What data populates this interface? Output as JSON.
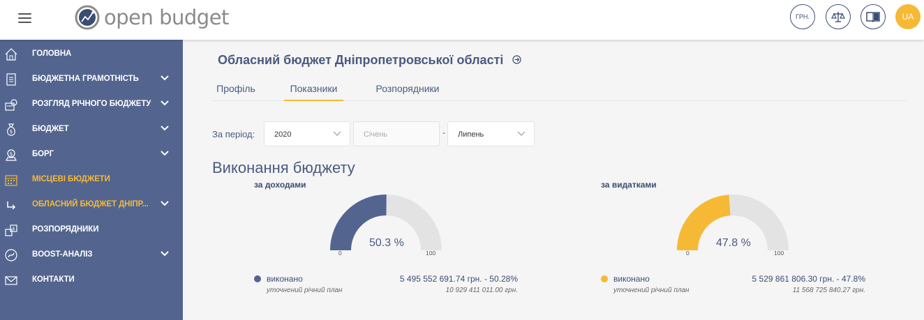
{
  "header": {
    "logo_text": "open budget",
    "currency_label": "ГРН.",
    "lang_label": "UA"
  },
  "sidebar": {
    "items": [
      {
        "label": "ГОЛОВНА",
        "icon": "home-icon",
        "chevron": false,
        "active": false
      },
      {
        "label": "БЮДЖЕТНА ГРАМОТНІСТЬ",
        "icon": "document-icon",
        "chevron": true,
        "active": false
      },
      {
        "label": "РОЗГЛЯД РІЧНОГО БЮДЖЕТУ",
        "icon": "money-icon",
        "chevron": true,
        "active": false
      },
      {
        "label": "БЮДЖЕТ",
        "icon": "money-bag-icon",
        "chevron": true,
        "active": false
      },
      {
        "label": "БОРГ",
        "icon": "debt-icon",
        "chevron": true,
        "active": false
      },
      {
        "label": "МІСЦЕВІ БЮДЖЕТИ",
        "icon": "calendar-icon",
        "chevron": false,
        "active": true
      },
      {
        "label": "ОБЛАСНИЙ БЮДЖЕТ ДНІПР...",
        "icon": "sub-arrow-icon",
        "chevron": true,
        "active": true
      },
      {
        "label": "РОЗПОРЯДНИКИ",
        "icon": "managers-icon",
        "chevron": false,
        "active": false
      },
      {
        "label": "BOOST-АНАЛІЗ",
        "icon": "boost-icon",
        "chevron": true,
        "active": false
      },
      {
        "label": "КОНТАКТИ",
        "icon": "mail-icon",
        "chevron": false,
        "active": false
      }
    ]
  },
  "main": {
    "title": "Обласний бюджет Дніпропетровської області",
    "tabs": [
      {
        "label": "Профіль",
        "active": false
      },
      {
        "label": "Показники",
        "active": true
      },
      {
        "label": "Розпорядники",
        "active": false
      }
    ],
    "period": {
      "label": "За період:",
      "year": "2020",
      "from_placeholder": "Січень",
      "separator": "-",
      "to": "Липень"
    },
    "section_title": "Виконання бюджету",
    "revenue": {
      "title": "за доходами",
      "percent": 50.3,
      "percent_label": "50.3 %",
      "min_label": "0",
      "max_label": "100",
      "color": "#53658f",
      "legend_label": "виконано",
      "legend_value": "5 495 552 691.74 грн. - 50.28%",
      "plan_label": "уточнений річний план",
      "plan_value": "10 929 411 011.00 грн."
    },
    "expenses": {
      "title": "за видатками",
      "percent": 47.8,
      "percent_label": "47.8 %",
      "min_label": "0",
      "max_label": "100",
      "color": "#f5b935",
      "legend_label": "виконано",
      "legend_value": "5 529 861 806.30 грн. - 47.8%",
      "plan_label": "уточнений річний план",
      "plan_value": "11 568 725 840.27 грн."
    },
    "gauge_track_color": "#e3e3e3"
  }
}
